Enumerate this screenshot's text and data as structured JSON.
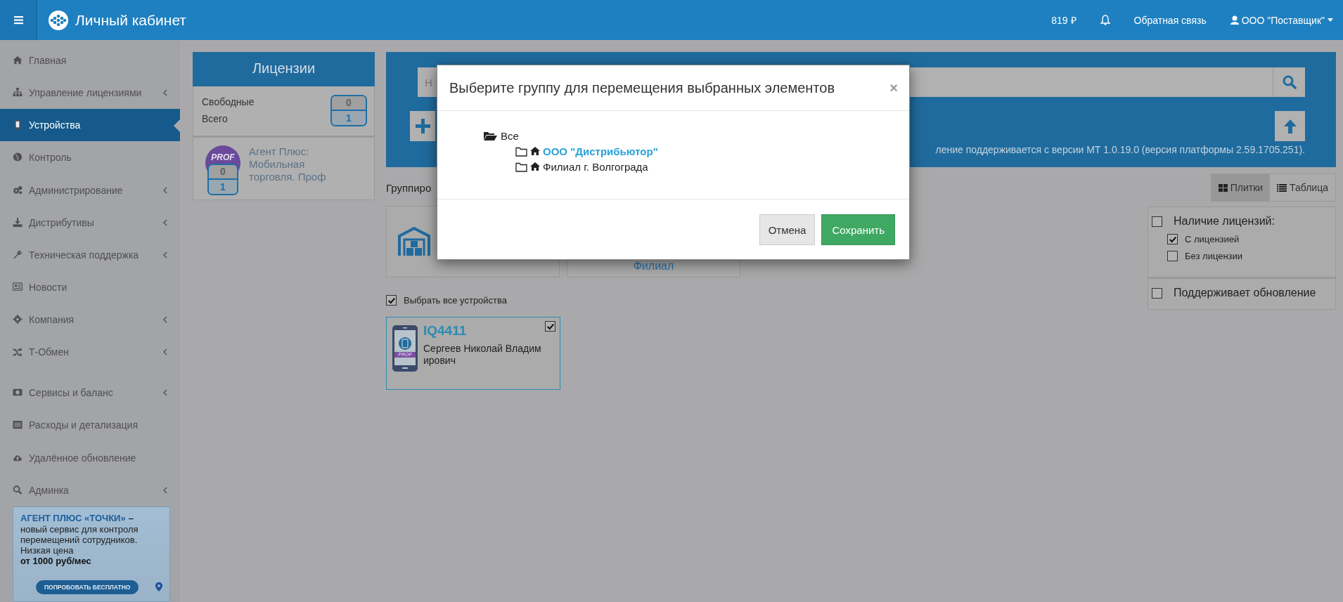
{
  "header": {
    "title": "Личный кабинет",
    "balance": "819 ₽",
    "feedback": "Обратная связь",
    "account": "ООО \"Поставщик\""
  },
  "sidebar": {
    "items": [
      {
        "label": "Главная",
        "selected": false,
        "submenu": false
      },
      {
        "label": "Управление лицензиями",
        "selected": false,
        "submenu": true
      },
      {
        "label": "Устройства",
        "selected": true,
        "submenu": false
      },
      {
        "label": "Контроль",
        "selected": false,
        "submenu": false
      },
      {
        "label": "Администрирование",
        "selected": false,
        "submenu": true
      },
      {
        "label": "Дистрибутивы",
        "selected": false,
        "submenu": true
      },
      {
        "label": "Техническая поддержка",
        "selected": false,
        "submenu": true
      },
      {
        "label": "Новости",
        "selected": false,
        "submenu": false
      },
      {
        "label": "Компания",
        "selected": false,
        "submenu": true
      },
      {
        "label": "Т-Обмен",
        "selected": false,
        "submenu": true
      },
      {
        "label": "Сервисы и баланс",
        "selected": false,
        "submenu": true
      },
      {
        "label": "Расходы и детализация",
        "selected": false,
        "submenu": false
      },
      {
        "label": "Удалённое обновление",
        "selected": false,
        "submenu": false
      },
      {
        "label": "Админка",
        "selected": false,
        "submenu": true
      }
    ],
    "promo": {
      "headline": "АГЕНТ ПЛЮС «ТОЧКИ»",
      "dash": "–",
      "text": "новый сервис для контроля перемещений сотрудников. Низкая цена",
      "price": "от 1000 руб/мес",
      "button": "ПОПРОБОВАТЬ БЕСПЛАТНО"
    }
  },
  "licenses": {
    "title": "Лицензии",
    "free_label": "Свободные",
    "total_label": "Всего",
    "free": "0",
    "total": "1",
    "products": [
      {
        "badge": "PROF",
        "name": "Агент Плюс: Мобильная торговля. Проф",
        "free": "0",
        "total": "1"
      }
    ]
  },
  "search": {
    "placeholder": "Н"
  },
  "info_text": "ление поддерживается с версии МТ 1.0.19.0 (версия платформы 2.59.1705.251).",
  "grouping_label": "Группиро",
  "view_tabs": [
    {
      "label": "Плитки",
      "selected": true
    },
    {
      "label": "Таблица",
      "selected": false
    }
  ],
  "groups": [
    {
      "kind": "warehouse"
    },
    {
      "kind": "branch",
      "label": "Филиал"
    }
  ],
  "select_all": {
    "label": "Выбрать все устройства",
    "checked": true
  },
  "devices": [
    {
      "name": "IQ4411",
      "user": "Сергеев Николай Владимирович",
      "badge": "PROF",
      "checked": true
    }
  ],
  "filters": [
    {
      "title": "Наличие лицензий:",
      "checked": false,
      "options": [
        {
          "label": "С лицензией",
          "checked": true
        },
        {
          "label": "Без лицензии",
          "checked": false
        }
      ]
    },
    {
      "title": "Поддерживает обновление",
      "checked": false
    }
  ],
  "dialog": {
    "title": "Выберите группу для перемещения выбранных элементов",
    "close": "×",
    "tree": {
      "label": "Все",
      "expanded": true,
      "children": [
        {
          "label": "ООО \"Дистрибьютор\"",
          "selected": true
        },
        {
          "label": "Филиал г. Волгограда",
          "selected": false
        }
      ]
    },
    "buttons": [
      {
        "label": "Отмена",
        "kind": "default"
      },
      {
        "label": "Сохранить",
        "kind": "primary"
      }
    ]
  }
}
